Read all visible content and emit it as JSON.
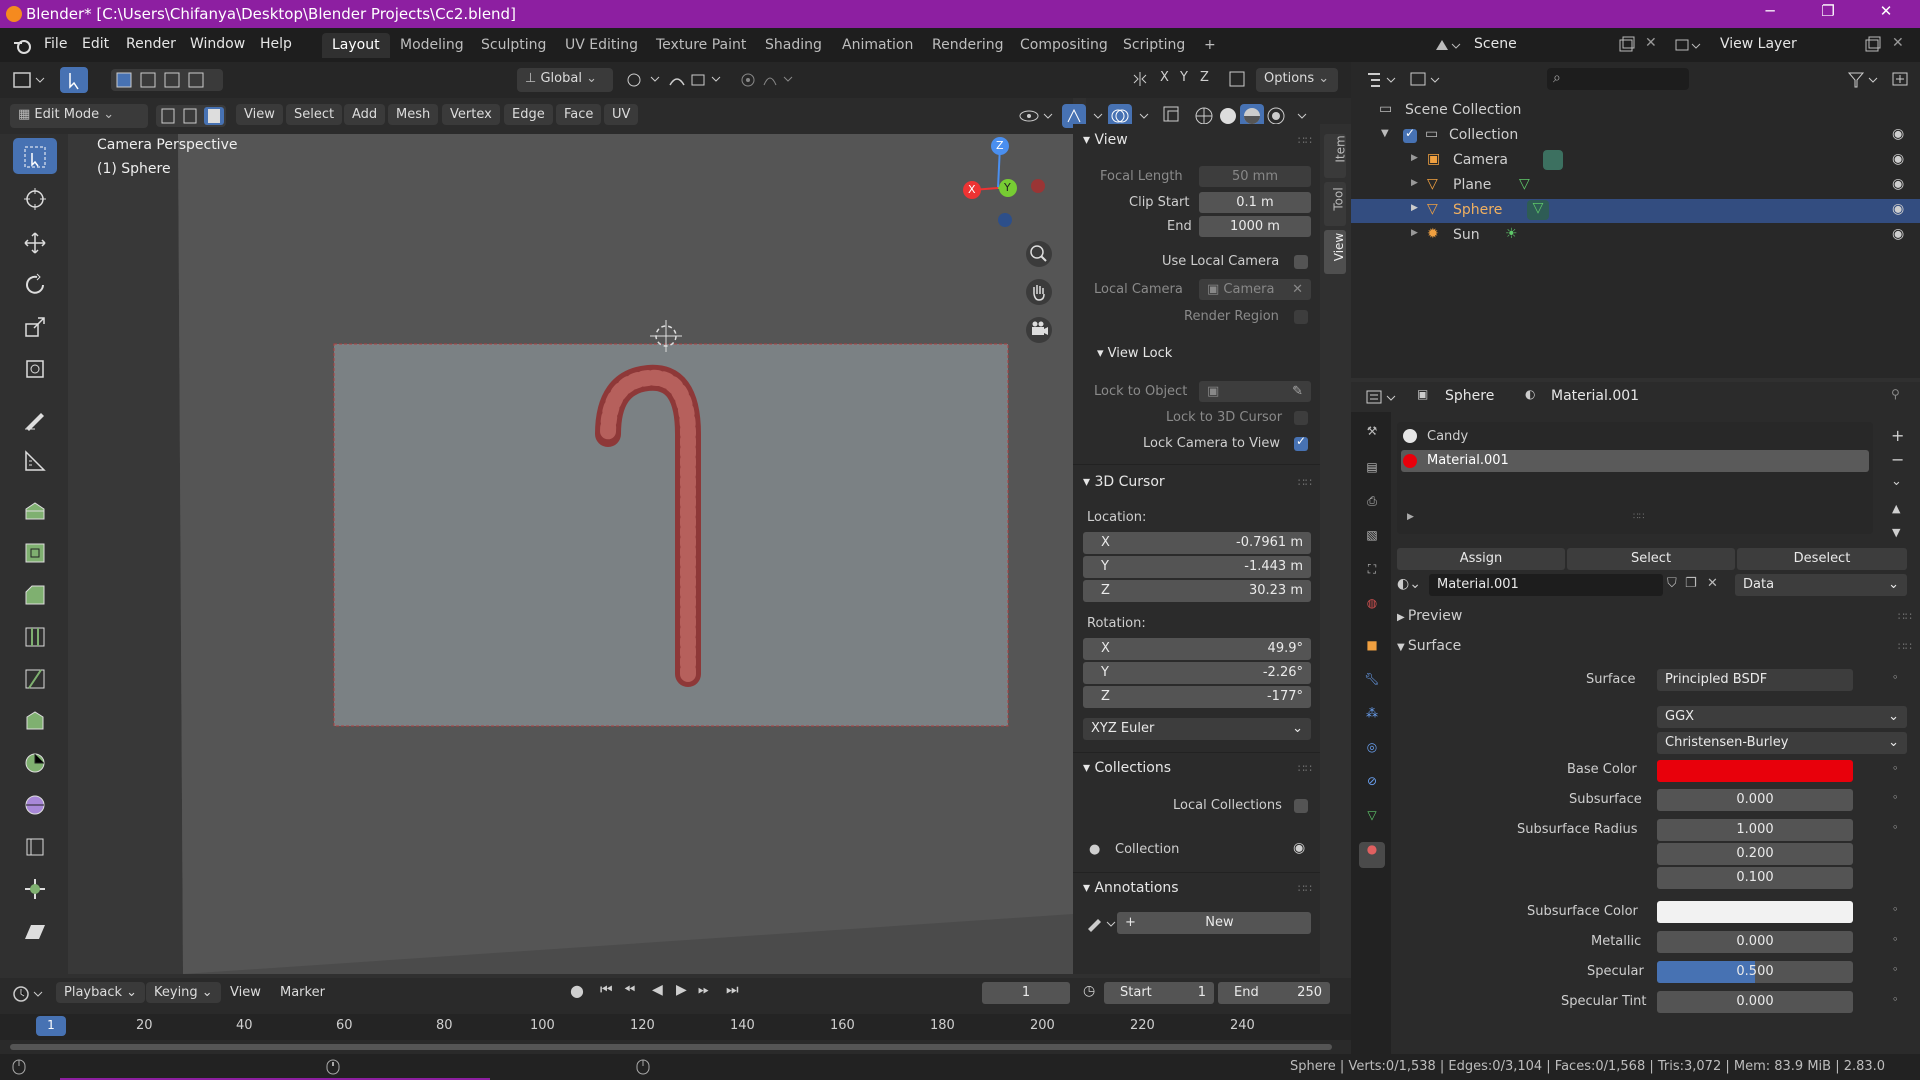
{
  "window": {
    "title": "Blender* [C:\\Users\\Chifanya\\Desktop\\Blender Projects\\Cc2.blend]",
    "minimize": "─",
    "maximize": "❐",
    "close": "✕"
  },
  "menu": {
    "items": [
      "File",
      "Edit",
      "Render",
      "Window",
      "Help"
    ],
    "workspaces": [
      "Layout",
      "Modeling",
      "Sculpting",
      "UV Editing",
      "Texture Paint",
      "Shading",
      "Animation",
      "Rendering",
      "Compositing",
      "Scripting"
    ],
    "add_tab": "+",
    "scene": "Scene",
    "view_layer": "View Layer"
  },
  "viewport_header": {
    "mode": "Edit Mode",
    "menus": [
      "View",
      "Select",
      "Add",
      "Mesh",
      "Vertex",
      "Edge",
      "Face",
      "UV"
    ],
    "transform_orientation": "Global",
    "options": "Options",
    "axes": [
      "X",
      "Y",
      "Z"
    ]
  },
  "viewport": {
    "overlay_title": "Camera Perspective",
    "overlay_object": "(1) Sphere",
    "gizmo": {
      "x": "X",
      "y": "Y",
      "z": "Z"
    }
  },
  "npanel": {
    "tabs": [
      "Item",
      "Tool",
      "View"
    ],
    "view": {
      "title": "View",
      "focal_length_label": "Focal Length",
      "focal_length": "50 mm",
      "clip_start_label": "Clip Start",
      "clip_start": "0.1 m",
      "end_label": "End",
      "end": "1000 m",
      "use_local_camera": "Use Local Camera",
      "local_camera_label": "Local Camera",
      "local_camera": "Camera",
      "render_region": "Render Region"
    },
    "view_lock": {
      "title": "View Lock",
      "lock_to_object": "Lock to Object",
      "lock_to_3d_cursor": "Lock to 3D Cursor",
      "lock_camera_to_view": "Lock Camera to View"
    },
    "cursor": {
      "title": "3D Cursor",
      "location_label": "Location:",
      "loc_x": "-0.7961 m",
      "loc_y": "-1.443 m",
      "loc_z": "30.23 m",
      "rotation_label": "Rotation:",
      "rot_x": "49.9°",
      "rot_y": "-2.26°",
      "rot_z": "-177°",
      "mode": "XYZ Euler",
      "x": "X",
      "y": "Y",
      "z": "Z"
    },
    "collections": {
      "title": "Collections",
      "local_collections": "Local Collections",
      "item": "Collection"
    },
    "annotations": {
      "title": "Annotations",
      "new": "New"
    }
  },
  "outliner": {
    "scene_collection": "Scene Collection",
    "collection": "Collection",
    "items": [
      "Camera",
      "Plane",
      "Sphere",
      "Sun"
    ]
  },
  "properties": {
    "object_name": "Sphere",
    "material_name": "Material.001",
    "slots": [
      "Candy",
      "Material.001"
    ],
    "assign": "Assign",
    "select": "Select",
    "deselect": "Deselect",
    "material_field": "Material.001",
    "link": "Data",
    "preview": "Preview",
    "surface_section": "Surface",
    "surface_label": "Surface",
    "surface_value": "Principled BSDF",
    "distribution": "GGX",
    "subsurface_method": "Christensen-Burley",
    "base_color_label": "Base Color",
    "base_color": "#e8000b",
    "subsurface_label": "Subsurface",
    "subsurface": "0.000",
    "subsurface_radius_label": "Subsurface Radius",
    "subsurface_radius": [
      "1.000",
      "0.200",
      "0.100"
    ],
    "subsurface_color_label": "Subsurface Color",
    "metallic_label": "Metallic",
    "metallic": "0.000",
    "specular_label": "Specular",
    "specular": "0.500",
    "specular_fraction": 0.5,
    "specular_tint_label": "Specular Tint",
    "specular_tint": "0.000"
  },
  "timeline": {
    "playback": "Playback",
    "keying": "Keying",
    "view": "View",
    "marker": "Marker",
    "current_frame": "1",
    "start_label": "Start",
    "start": "1",
    "end_label": "End",
    "end": "250",
    "frame_indicator": "1",
    "ticks": [
      "20",
      "40",
      "60",
      "80",
      "100",
      "120",
      "140",
      "160",
      "180",
      "200",
      "220",
      "240"
    ]
  },
  "status": {
    "text": "Sphere | Verts:0/1,538 | Edges:0/3,104 | Faces:0/1,568 | Tris:3,072 | Mem: 83.9 MiB | 2.83.0"
  }
}
